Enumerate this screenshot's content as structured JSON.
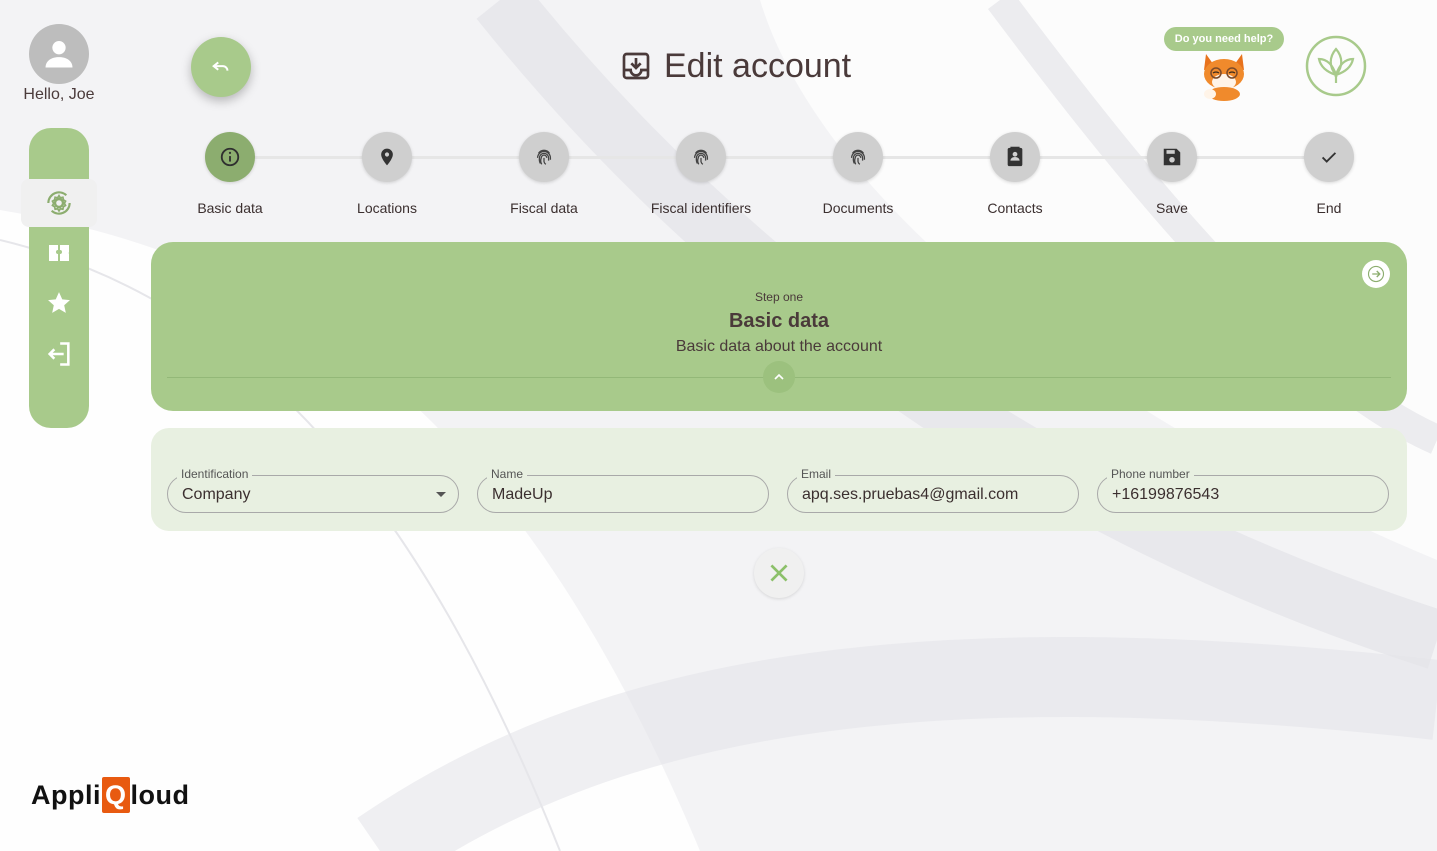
{
  "user": {
    "greeting": "Hello, Joe"
  },
  "sidebar": {
    "items": [
      {
        "icon": "settings-sync-icon",
        "active": true
      },
      {
        "icon": "ticket-icon"
      },
      {
        "icon": "star-icon"
      },
      {
        "icon": "logout-icon"
      }
    ]
  },
  "header": {
    "title": "Edit account",
    "help_text": "Do you need help?"
  },
  "stepper": {
    "steps": [
      {
        "label": "Basic data",
        "icon": "info-icon",
        "active": true
      },
      {
        "label": "Locations",
        "icon": "location-pin-icon"
      },
      {
        "label": "Fiscal data",
        "icon": "fingerprint-icon"
      },
      {
        "label": "Fiscal identifiers",
        "icon": "fingerprint-icon"
      },
      {
        "label": "Documents",
        "icon": "fingerprint-icon"
      },
      {
        "label": "Contacts",
        "icon": "contact-card-icon"
      },
      {
        "label": "Save",
        "icon": "save-icon"
      },
      {
        "label": "End",
        "icon": "check-icon"
      }
    ]
  },
  "panel": {
    "kicker": "Step one",
    "heading": "Basic data",
    "description": "Basic data about the account"
  },
  "form": {
    "identification": {
      "label": "Identification",
      "value": "Company"
    },
    "name": {
      "label": "Name",
      "value": "MadeUp"
    },
    "email": {
      "label": "Email",
      "value": "apq.ses.pruebas4@gmail.com"
    },
    "phone": {
      "label": "Phone number",
      "value": "+16199876543"
    }
  },
  "brand": {
    "before": "Appli",
    "q": "Q",
    "after": "loud"
  },
  "colors": {
    "accent": "#a8ca8b",
    "accent_dark": "#8cad6f",
    "form_bg": "#e8f0e1",
    "brand_orange": "#e85a10"
  }
}
